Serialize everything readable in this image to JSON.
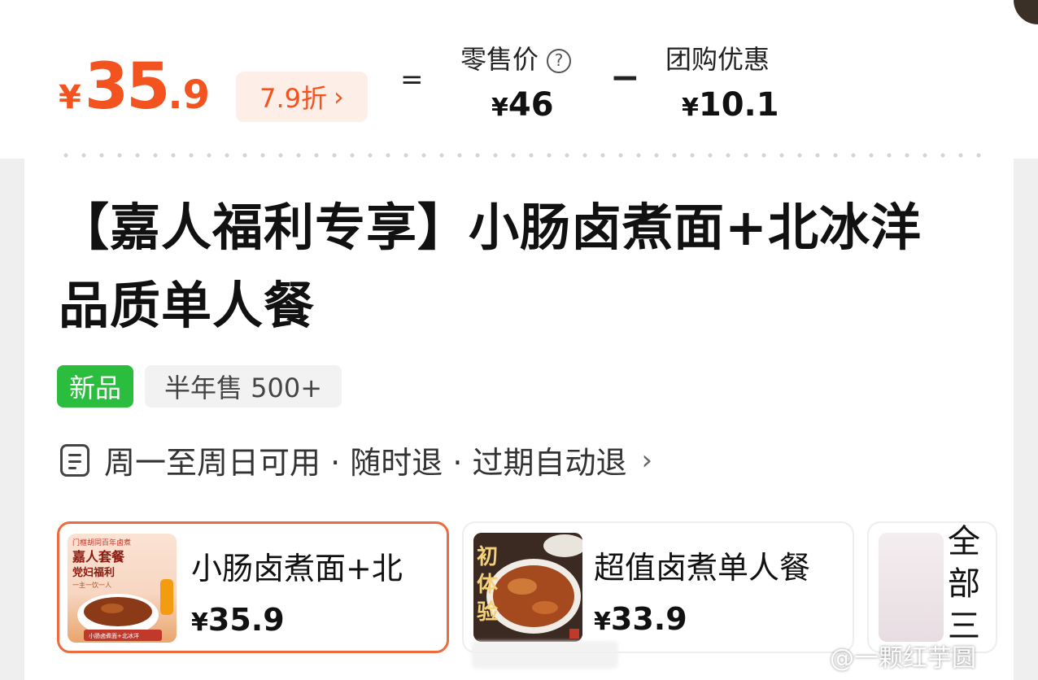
{
  "price": {
    "currency": "¥",
    "integer": "35",
    "decimal": ".9"
  },
  "discount": {
    "label": "7.9折",
    "arrow": "›"
  },
  "equation": {
    "equals": "=",
    "minus": "−"
  },
  "retail": {
    "label": "零售价",
    "help": "?",
    "currency": "¥",
    "value": "46"
  },
  "group": {
    "label": "团购优惠",
    "currency": "¥",
    "value": "10.1"
  },
  "title": "【嘉人福利专享】小肠卤煮面+北冰洋品质单人餐",
  "tags": {
    "new": "新品",
    "sales": "半年售 500+"
  },
  "rules": {
    "text": "周一至周日可用 · 随时退 · 过期自动退",
    "arrow": "›"
  },
  "packages": [
    {
      "name": "小肠卤煮面+北",
      "currency": "¥",
      "price": "35.9",
      "selected": true,
      "thumb_texts": [
        "门框胡同百年卤煮",
        "嘉人套餐",
        "党妇福利",
        "一主一饮一人",
        "小肠卤煮面+北冰洋"
      ]
    },
    {
      "name": "超值卤煮单人餐",
      "currency": "¥",
      "price": "33.9",
      "selected": false,
      "thumb_texts": [
        "初",
        "体",
        "验"
      ]
    }
  ],
  "all_packages_label": "全部",
  "all_packages_partial": "三",
  "watermark": "@一颗红芋圆",
  "colors": {
    "accent": "#f2531f",
    "new_tag": "#2bbd3d",
    "selected_border": "#ee6a3f"
  }
}
